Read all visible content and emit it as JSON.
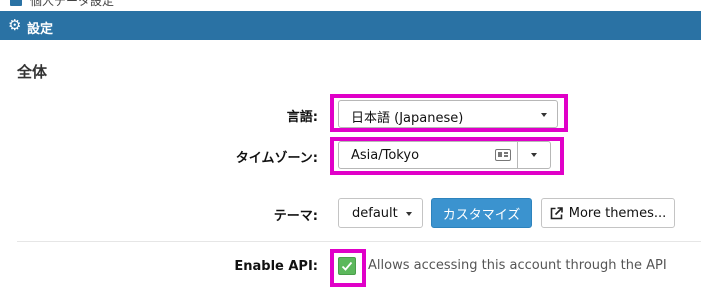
{
  "top": {
    "title": "個人データ設定"
  },
  "header": {
    "icon": "gear-icon",
    "title": "設定"
  },
  "section": {
    "title": "全体"
  },
  "language": {
    "label": "言語:",
    "value": "日本語 (Japanese)"
  },
  "timezone": {
    "label": "タイムゾーン:",
    "value": "Asia/Tokyo"
  },
  "theme": {
    "label": "テーマ:",
    "value": "default",
    "customize_label": "カスタマイズ",
    "more_label": "More themes..."
  },
  "api": {
    "label": "Enable API:",
    "checked": true,
    "description": "Allows accessing this account through the API"
  },
  "colors": {
    "header_bg": "#2a72a4",
    "primary_button": "#3b93cf",
    "checkbox": "#5cb85c",
    "highlight": "#e000c8"
  }
}
